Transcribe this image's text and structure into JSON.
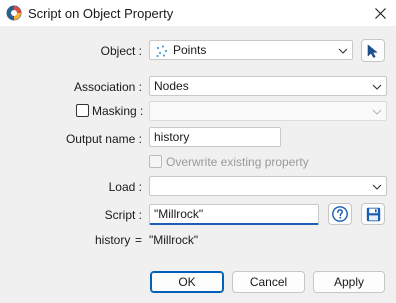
{
  "window": {
    "title": "Script on Object Property"
  },
  "object": {
    "label": "Object :",
    "value": "Points"
  },
  "association": {
    "label": "Association :",
    "value": "Nodes"
  },
  "masking": {
    "label": "Masking :",
    "value": ""
  },
  "output_name": {
    "label": "Output name :",
    "value": "history"
  },
  "overwrite": {
    "label": "Overwrite existing property"
  },
  "load": {
    "label": "Load :",
    "value": ""
  },
  "script": {
    "label": "Script :",
    "value": "\"Millrock\""
  },
  "preview": {
    "name": "history",
    "equals": "=",
    "value": "\"Millrock\""
  },
  "buttons": {
    "ok": "OK",
    "cancel": "Cancel",
    "apply": "Apply"
  },
  "colors": {
    "accent": "#005fb8",
    "focus_underline": "#1a5fb4",
    "help_icon": "#1a5fb4",
    "save_icon": "#1a5fb4"
  }
}
